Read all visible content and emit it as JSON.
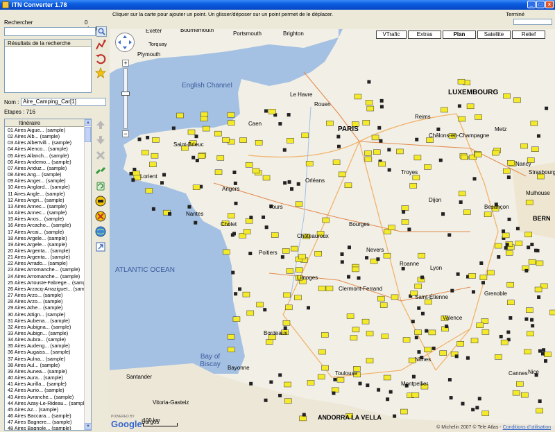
{
  "window": {
    "title": "ITN Converter 1.78"
  },
  "search": {
    "label": "Rechercher",
    "count": "0 résultats",
    "results_header": "Résultats de la recherche"
  },
  "route": {
    "name_label": "Nom :",
    "name_value": "Aire_Camping_Car[1]",
    "steps": "Etapes : 716",
    "list_header": "Itinéraire"
  },
  "itinerary": [
    "01  Aires Aigue... (sample)",
    "02  Aires Alb... (sample)",
    "03  Aires Albertvill... (sample)",
    "04  Aires Alenco... (sample)",
    "05  Aires Allanch... (sample)",
    "06  Aires Andemo... (sample)",
    "07  Aires Anduz... (sample)",
    "08  Aires Ang... (sample)",
    "09  Aires Anger... (sample)",
    "10  Aires Anglard... (sample)",
    "11  Aires Angle... (sample)",
    "12  Aires Angri... (sample)",
    "13  Aires Annec... (sample)",
    "14  Aires Annec... (sample)",
    "15  Aires Anos... (sample)",
    "16  Aires Arcacho... (sample)",
    "17  Aires Arcai... (sample)",
    "18  Aires Argele... (sample)",
    "19  Aires Argele... (sample)",
    "20  Aires Argenta... (sample)",
    "21  Aires Argenta... (sample)",
    "22  Aires Arrado... (sample)",
    "23  Aires Arromanche... (sample)",
    "24  Aires Arromanche... (sample)",
    "25  Aires Artouste-Fabrege... (sample)",
    "26  Aires Arzacq-Arraziguet... (sample)",
    "27  Aires Arzo... (sample)",
    "28  Aires Arzo... (sample)",
    "29  Aires Athe... (sample)",
    "30  Aires Attign... (sample)",
    "31  Aires Aubena... (sample)",
    "32  Aires Aubigna... (sample)",
    "33  Aires Aubign... (sample)",
    "34  Aires Aubra... (sample)",
    "35  Aires Audeng... (sample)",
    "36  Aires Augaiss... (sample)",
    "37  Aires Aulna... (sample)",
    "38  Aires Aul... (sample)",
    "39  Aires Aunea... (sample)",
    "40  Aires Aura... (sample)",
    "41  Aires Aurilla... (sample)",
    "42  Aires Aurio... (sample)",
    "43  Aires Avranche... (sample)",
    "44  Aires Azay-Le-Rideau... (sample)",
    "45  Aires Az... (sample)",
    "46  Aires Baccara... (sample)",
    "47  Aires Bagnere... (sample)",
    "48  Aires Bagnole... (sample)"
  ],
  "map": {
    "hint": "Cliquer sur la carte pour ajouter un point. Un glisser/déposer sur un point permet de le déplacer.",
    "status": "Terminé",
    "types": [
      "VTrafic",
      "Extras",
      "Plan",
      "Satellite",
      "Relief"
    ],
    "active_type": "Plan",
    "scale_label": "100 km",
    "copyright": "© Michelin 2007 © Tele Atlas -",
    "terms": "Conditions d'utilisation",
    "powered_by": "POWERED BY",
    "google": "Google",
    "labels": {
      "english_channel": "English Channel",
      "atlantic": "ATLANTIC OCEAN",
      "biscay": "Bay of Biscay",
      "paris": "PARIS",
      "luxembourg": "LUXEMBOURG",
      "bern": "BERN",
      "andorra": "ANDORRA LA VELLA",
      "exeter": "Exeter",
      "plymouth": "Plymouth",
      "bournemouth": "Bournemouth",
      "portsmouth": "Portsmouth",
      "brighton": "Brighton",
      "torquay": "Torquay",
      "orleans": "Orléans",
      "clermont": "Clermont-Ferrand",
      "bordeaux": "Bordeaux",
      "toulouse": "Toulouse",
      "lyon": "Lyon",
      "dijon": "Dijon",
      "nantes": "Nantes",
      "limoges": "Limoges",
      "poitiers": "Poitiers",
      "bourges": "Bourges",
      "reims": "Reims",
      "chalons": "Châlons-en-Champagne",
      "mulhouse": "Mulhouse",
      "besancon": "Besançon",
      "grenoble": "Grenoble",
      "valence": "Valence",
      "nimes": "Nîmes",
      "montpellier": "Montpellier",
      "cannes": "Cannes",
      "nice": "Nice",
      "bayonne": "Bayonne",
      "santander": "Santander",
      "vitoria": "Vitoria-Gasteiz",
      "burgos": "Burgos",
      "caen": "Caen",
      "rouen": "Rouen",
      "le_havre": "Le Havre",
      "tours": "Tours",
      "chateauroux": "Châteauroux",
      "metz": "Metz",
      "nancy": "Nancy",
      "strasbourg": "Strasbourg",
      "troyes": "Troyes",
      "saint_etienne": "Saint-Étienne",
      "nevers": "Nevers",
      "roanne": "Roanne",
      "cholet": "Cholet",
      "angers": "Angers",
      "lorient": "Lorient",
      "saint_brieuc": "Saint-Brieuc"
    }
  },
  "icons": [
    "search-icon",
    "route-icon",
    "undo-icon",
    "star-icon",
    "arrow-up-icon",
    "arrow-down-icon",
    "delete-icon",
    "split-icon",
    "recycle-icon",
    "car-icon",
    "no-entry-icon",
    "globe-icon",
    "export-icon"
  ]
}
